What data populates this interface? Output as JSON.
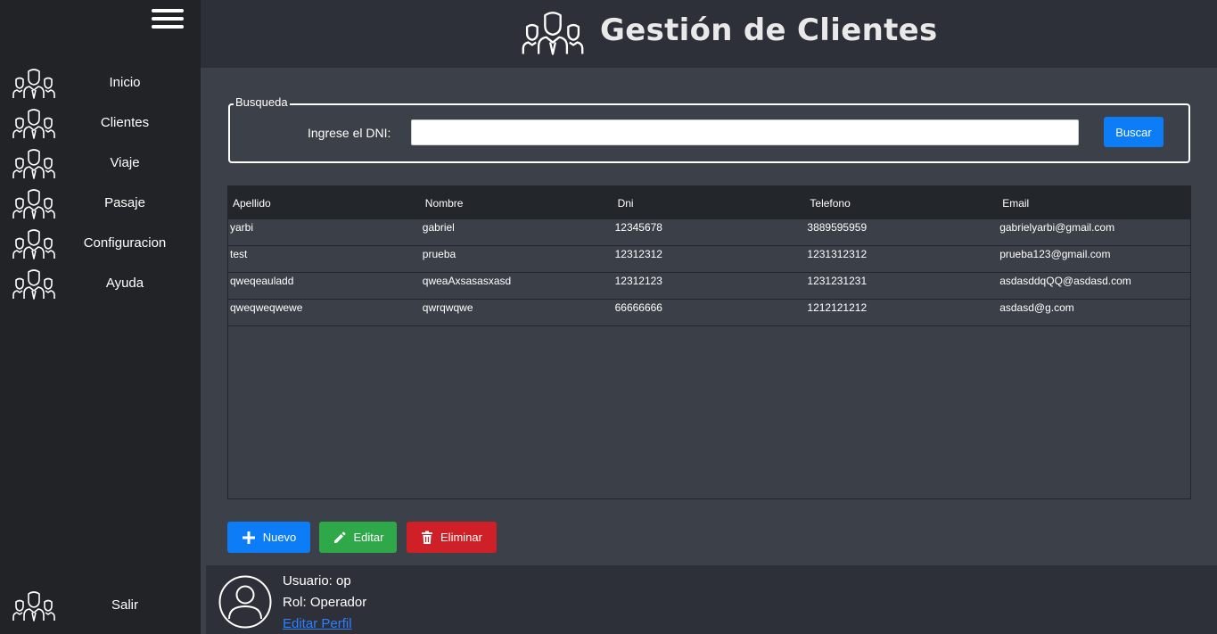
{
  "header": {
    "title": "Gestión de Clientes",
    "icon": "group-icon"
  },
  "sidebar": {
    "menu_icon": "hamburger-menu-icon",
    "items": [
      {
        "label": "Inicio",
        "icon": "group-icon"
      },
      {
        "label": "Clientes",
        "icon": "group-icon"
      },
      {
        "label": "Viaje",
        "icon": "group-icon"
      },
      {
        "label": "Pasaje",
        "icon": "group-icon"
      },
      {
        "label": "Configuracion",
        "icon": "group-icon"
      },
      {
        "label": "Ayuda",
        "icon": "group-icon"
      }
    ],
    "logout": {
      "label": "Salir",
      "icon": "group-icon"
    }
  },
  "search": {
    "legend": "Busqueda",
    "label": "Ingrese el DNI:",
    "value": "",
    "placeholder": "",
    "button": "Buscar"
  },
  "table": {
    "columns": [
      "Apellido",
      "Nombre",
      "Dni",
      "Telefono",
      "Email"
    ],
    "rows": [
      [
        "yarbi",
        "gabriel",
        "12345678",
        "3889595959",
        "gabrielyarbi@gmail.com"
      ],
      [
        "test",
        "prueba",
        "12312312",
        "1231312312",
        "prueba123@gmail.com"
      ],
      [
        "qweqeauladd",
        "qweaAxsasasxasd",
        "12312123",
        "1231231231",
        "asdasddqQQ@asdasd.com"
      ],
      [
        "qweqweqwewe",
        "qwrqwqwe",
        "66666666",
        "1212121212",
        "asdasd@g.com"
      ]
    ]
  },
  "actions": {
    "new": {
      "label": "Nuevo",
      "icon": "plus-icon"
    },
    "edit": {
      "label": "Editar",
      "icon": "pencil-icon"
    },
    "delete": {
      "label": "Eliminar",
      "icon": "trash-icon"
    }
  },
  "user": {
    "usuario": "Usuario: op",
    "rol": "Rol: Operador",
    "edit_profile": "Editar Perfil",
    "avatar_icon": "user-avatar-icon"
  },
  "colors": {
    "sidebar_bg": "#212326",
    "main_bg": "#3c4048",
    "header_bg": "#2d3038",
    "primary": "#0d7df7",
    "success": "#2fa84a",
    "danger": "#cf2027",
    "link": "#2f80ff"
  }
}
